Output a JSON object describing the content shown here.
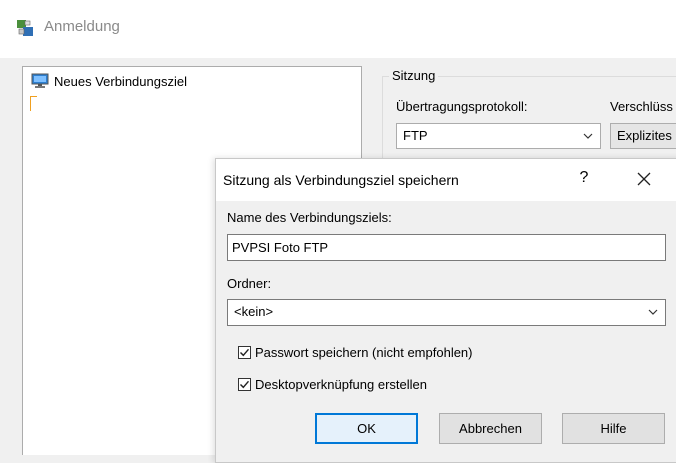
{
  "main_window": {
    "title": "Anmeldung",
    "tree": {
      "items": [
        {
          "label": "Neues Verbindungsziel"
        }
      ]
    },
    "session": {
      "group_label": "Sitzung",
      "protocol_label": "Übertragungsprotokoll:",
      "protocol_value": "FTP",
      "encryption_label": "Verschlüss",
      "encryption_value": "Explizites"
    }
  },
  "dialog": {
    "title": "Sitzung als Verbindungsziel speichern",
    "help_label": "?",
    "name_label": "Name des Verbindungsziels:",
    "name_value": "PVPSI Foto FTP",
    "folder_label": "Ordner:",
    "folder_value": "<kein>",
    "checkboxes": [
      {
        "label": "Passwort speichern (nicht empfohlen)",
        "checked": true
      },
      {
        "label": "Desktopverknüpfung erstellen",
        "checked": true
      }
    ],
    "buttons": {
      "ok": "OK",
      "cancel": "Abbrechen",
      "help": "Hilfe"
    }
  },
  "colors": {
    "focus_border": "#0078d7",
    "window_bg": "#f0f0f0",
    "title_gray": "#8a8a8a"
  },
  "icons": [
    "app-icon",
    "computer-icon",
    "chevron-down-icon",
    "close-icon",
    "checkmark-icon"
  ]
}
